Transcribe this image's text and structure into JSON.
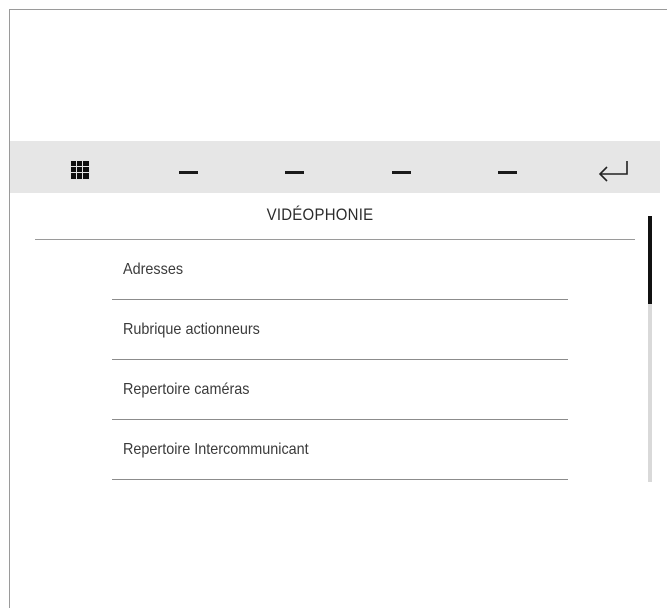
{
  "toolbar": {
    "icons": [
      "grid-icon",
      "dash-icon",
      "dash-icon",
      "dash-icon",
      "dash-icon",
      "back-arrow-icon"
    ],
    "background": "#e6e6e6"
  },
  "header": {
    "title": "VIDÉOPHONIE"
  },
  "menu": {
    "items": [
      {
        "label": "Adresses"
      },
      {
        "label": "Rubrique actionneurs"
      },
      {
        "label": "Repertoire caméras"
      },
      {
        "label": "Repertoire Intercommunicant"
      }
    ]
  },
  "scrollbar": {
    "position": 0.0,
    "visible_fraction": 0.33
  }
}
